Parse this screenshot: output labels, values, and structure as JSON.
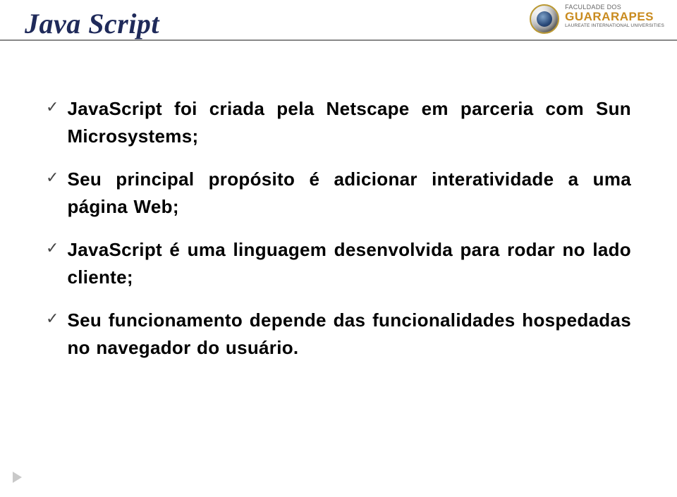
{
  "title": "Java Script",
  "logo": {
    "small": "FACULDADE DOS",
    "big": "GUARARAPES",
    "sub": "LAUREATE INTERNATIONAL UNIVERSITIES"
  },
  "bullets": [
    "JavaScript foi criada pela Netscape em parceria com Sun Microsystems;",
    "Seu principal propósito é adicionar interatividade a uma página Web;",
    "JavaScript é uma linguagem desenvolvida para rodar no lado cliente;",
    "Seu funcionamento depende das funcionalidades hospedadas no navegador do usuário."
  ]
}
